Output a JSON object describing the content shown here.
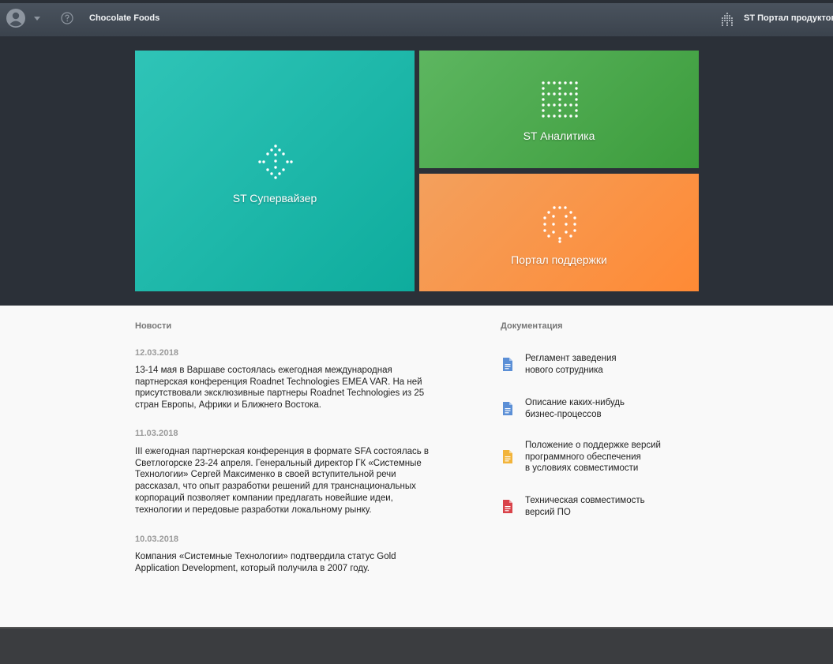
{
  "header": {
    "company": "Chocolate Foods",
    "portal_title": "ST Портал продуктов",
    "icons": [
      "user-avatar-icon",
      "chevron-down-icon",
      "help-icon",
      "dot-grid-logo-icon"
    ]
  },
  "tiles": {
    "supervisor": {
      "label": "ST Супервайзер",
      "color": "#17b3a5"
    },
    "analytics": {
      "label": "ST Аналитика",
      "color": "#48a84a"
    },
    "support": {
      "label": "Портал поддержки",
      "color": "#fb9444"
    }
  },
  "news": {
    "title": "Новости",
    "items": [
      {
        "date": "12.03.2018",
        "text": "13-14 мая в Варшаве состоялась ежегодная международная партнерская конференция Roadnet Technologies EMEA VAR. На ней присутствовали эксклюзивные партнеры Roadnet Technologies из 25 стран Европы, Африки и Ближнего Востока."
      },
      {
        "date": "11.03.2018",
        "text": "III ежегодная партнерская конференция в формате SFA состоялась в Светлогорске 23-24 апреля. Генеральный директор ГК «Системные Технологии» Сергей Максименко в своей вступительной речи рассказал, что опыт разработки решений для транснациональных корпораций позволяет компании предлагать новейшие идеи, технологии и передовые разработки локальному рынку."
      },
      {
        "date": "10.03.2018",
        "text": "Компания «Системные Технологии» подтвердила статус Gold Application Development, который получила в 2007 году."
      }
    ]
  },
  "docs": {
    "title": "Документация",
    "items": [
      {
        "label": "Регламент заведения\nнового сотрудника",
        "icon": "document-icon",
        "color": "#5b8fd6"
      },
      {
        "label": "Описание каких-нибудь\nбизнес-процессов",
        "icon": "document-icon",
        "color": "#5b8fd6"
      },
      {
        "label": "Положение о поддержке версий\nпрограммного обеспечения\nв условиях совместимости",
        "icon": "document-icon",
        "color": "#f2b43a"
      },
      {
        "label": "Техническая совместимость\nверсий ПО",
        "icon": "document-icon",
        "color": "#d9434a"
      }
    ]
  }
}
